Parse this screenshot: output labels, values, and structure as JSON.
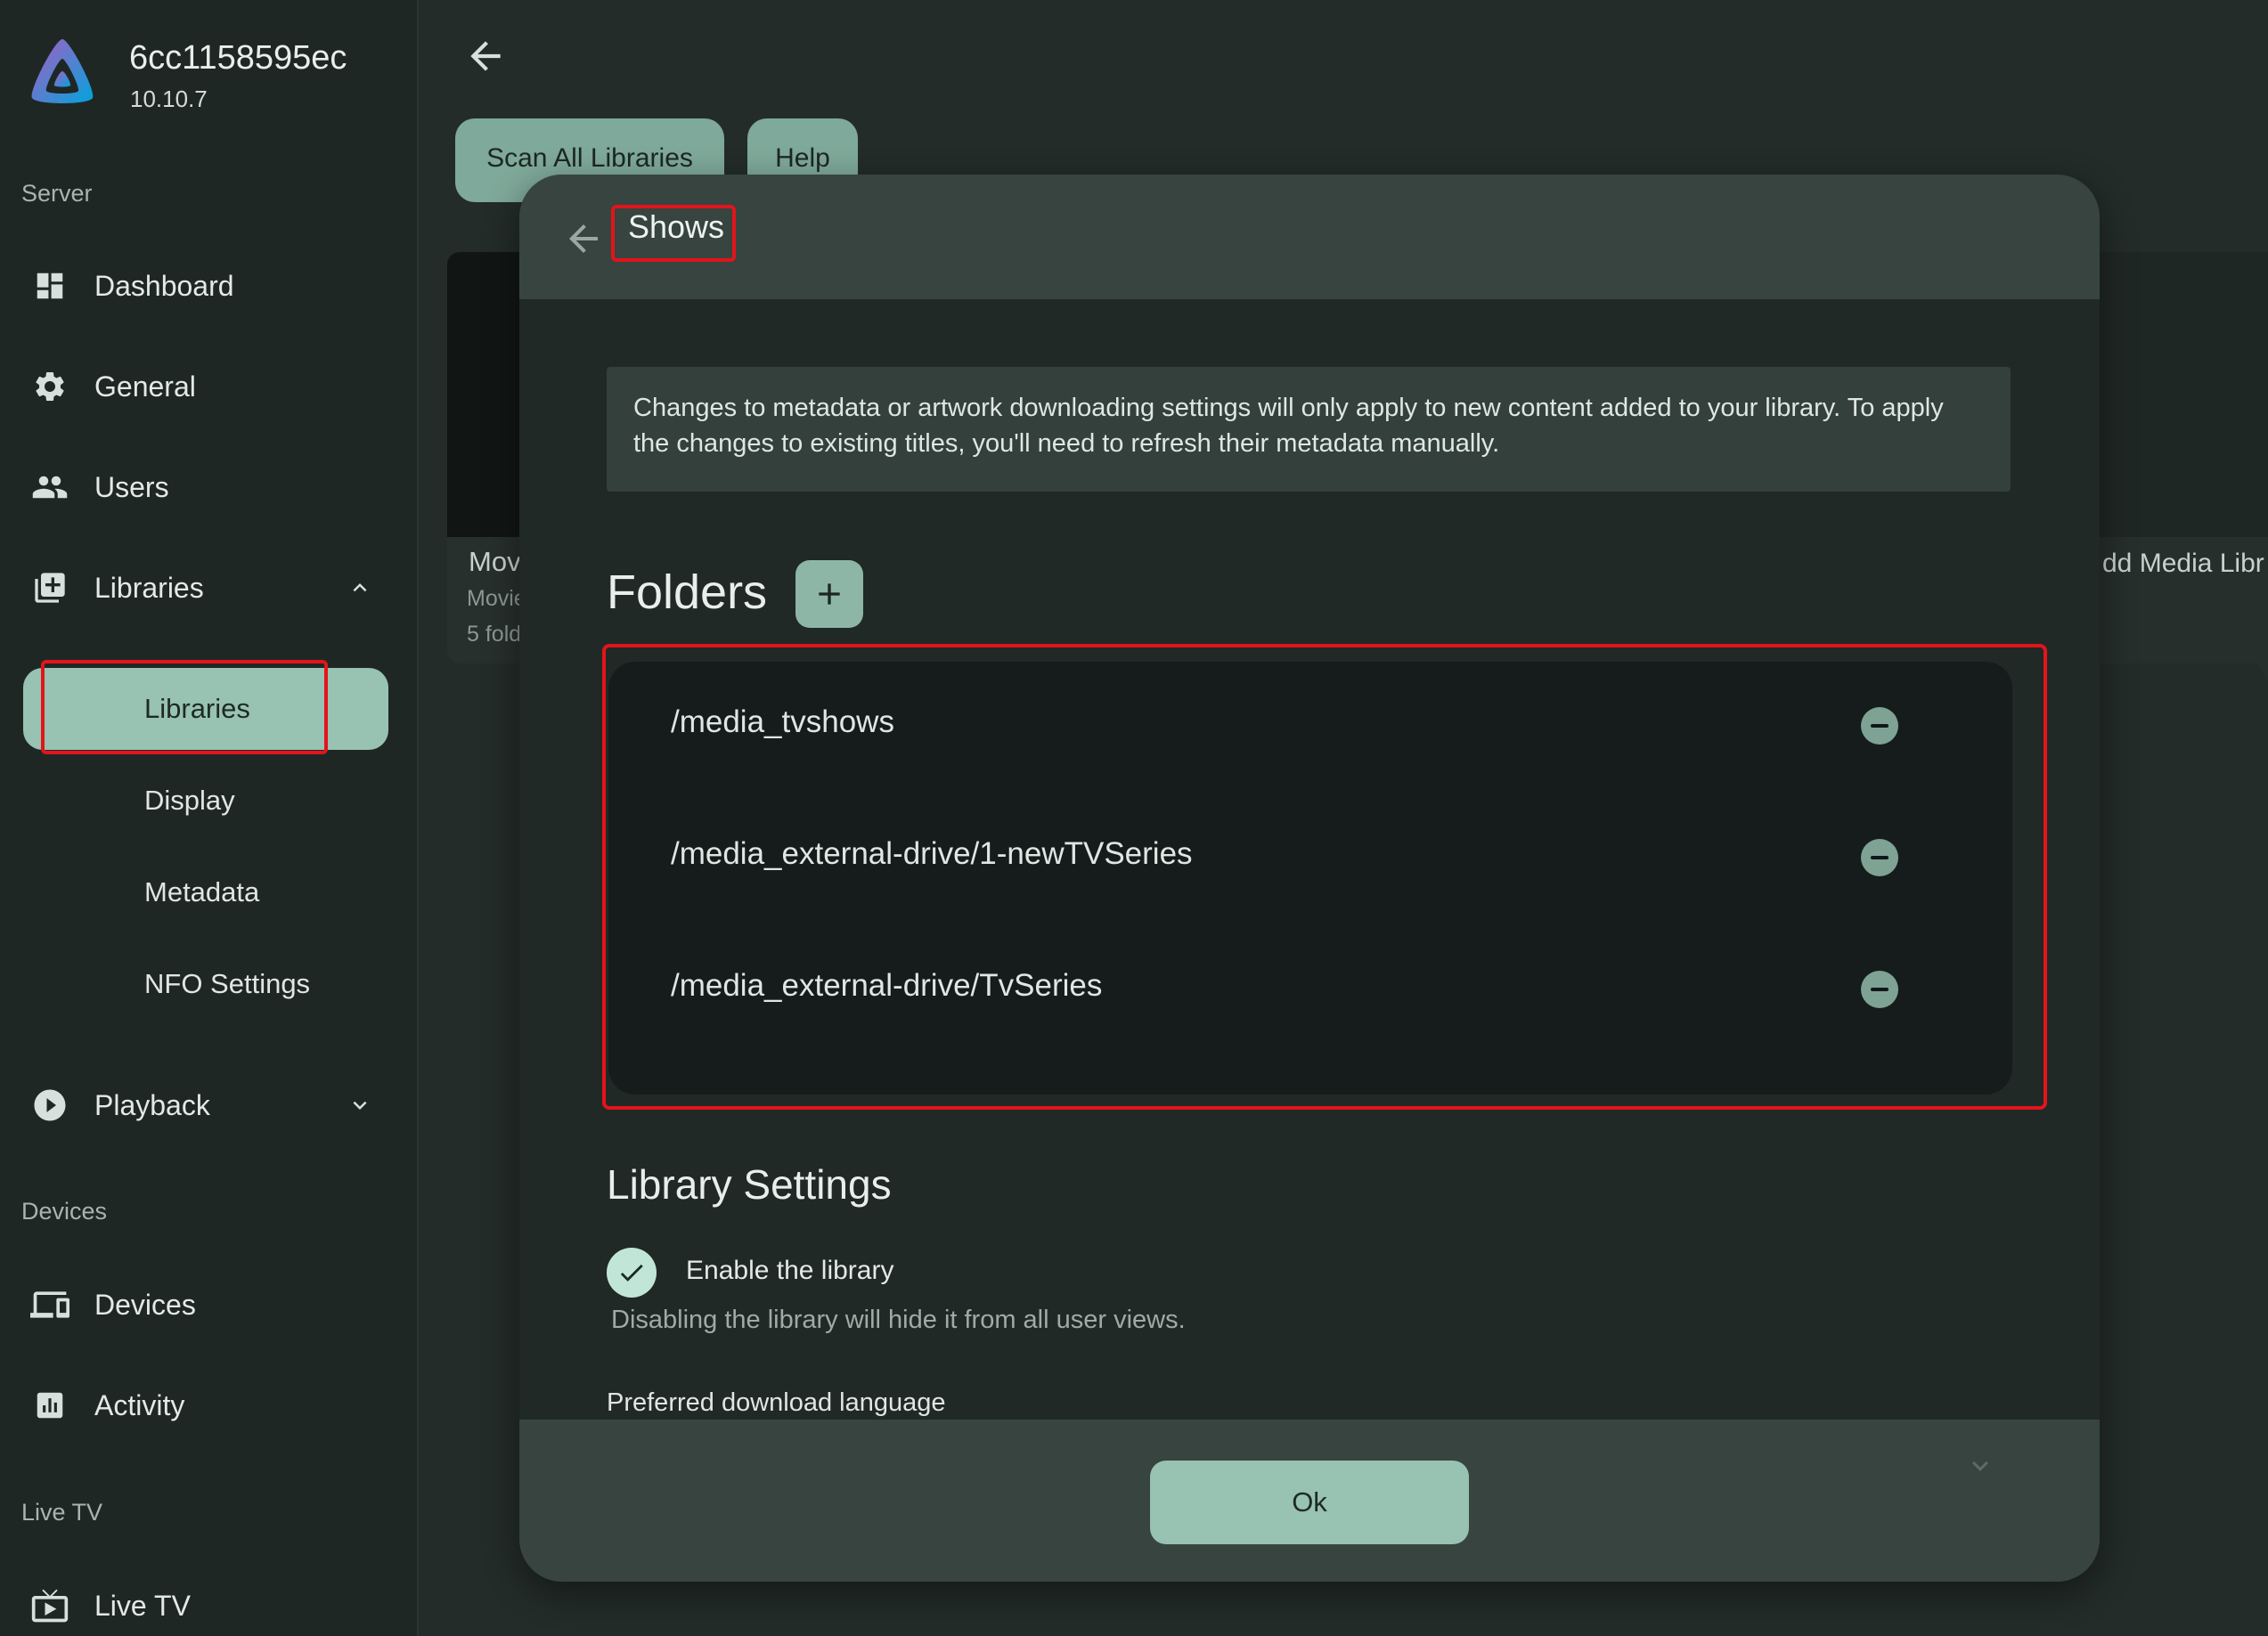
{
  "server": {
    "name": "6cc1158595ec",
    "version": "10.10.7"
  },
  "sidebar": {
    "sections": {
      "server": "Server",
      "devices": "Devices",
      "live_tv": "Live TV"
    },
    "items": {
      "dashboard": "Dashboard",
      "general": "General",
      "users": "Users",
      "libraries": "Libraries",
      "playback": "Playback",
      "devices": "Devices",
      "activity": "Activity",
      "live_tv": "Live TV"
    },
    "libraries_sub": [
      "Libraries",
      "Display",
      "Metadata",
      "NFO Settings"
    ]
  },
  "toolbar": {
    "scan_all": "Scan All Libraries",
    "help": "Help"
  },
  "bg_cards": {
    "movies": {
      "title": "Mov",
      "type": "Movie",
      "folders": "5 fold"
    },
    "add": {
      "title": "dd Media Libr"
    }
  },
  "dialog": {
    "title": "Shows",
    "notice": "Changes to metadata or artwork downloading settings will only apply to new content added to your library. To apply the changes to existing titles, you'll need to refresh their metadata manually.",
    "folders_heading": "Folders",
    "folders": [
      "/media_tvshows",
      "/media_external-drive/1-newTVSeries",
      "/media_external-drive/TvSeries"
    ],
    "library_settings_heading": "Library Settings",
    "enable_library": {
      "label": "Enable the library",
      "checked": true,
      "help": "Disabling the library will hide it from all user views."
    },
    "preferred_language_label": "Preferred download language",
    "ok": "Ok"
  },
  "colors": {
    "accent": "#98c2b2",
    "highlight_box": "#e3141b",
    "background": "#232c29"
  }
}
